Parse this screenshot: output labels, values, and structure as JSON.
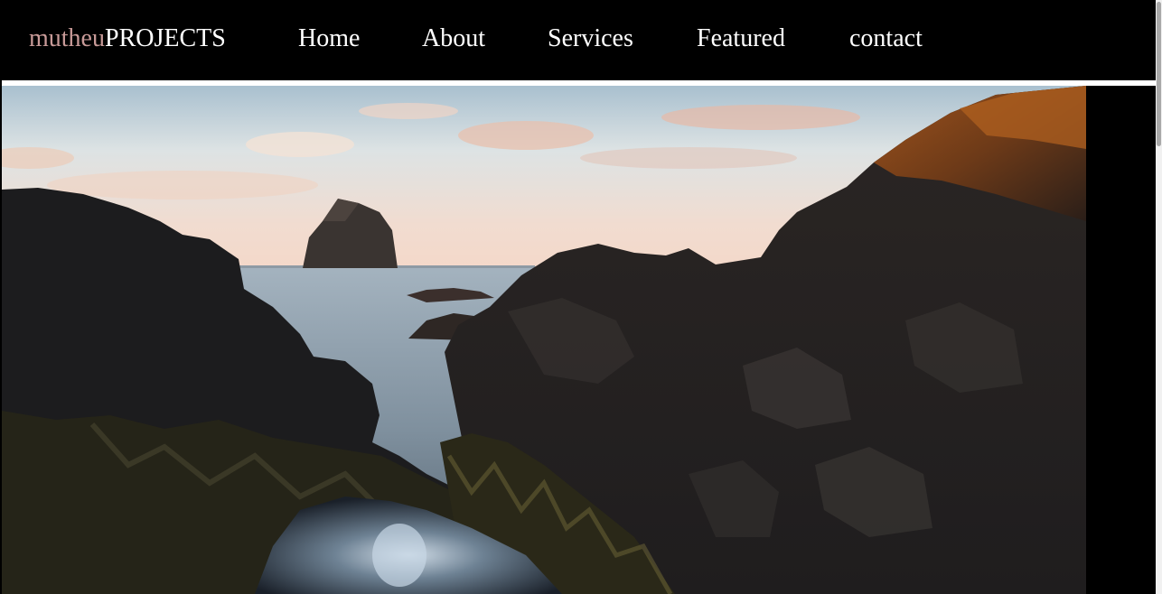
{
  "brand": {
    "part1": "mutheu",
    "part2": "PROJECTS"
  },
  "nav": {
    "home": "Home",
    "about": "About",
    "services": "Services",
    "featured": "Featured",
    "contact": "contact"
  },
  "colors": {
    "background": "#000000",
    "nav_text": "#ffffff",
    "brand_accent": "#c89a98",
    "divider": "#ffffff"
  },
  "hero": {
    "image": "coastal-rocks-sunset-photo"
  }
}
